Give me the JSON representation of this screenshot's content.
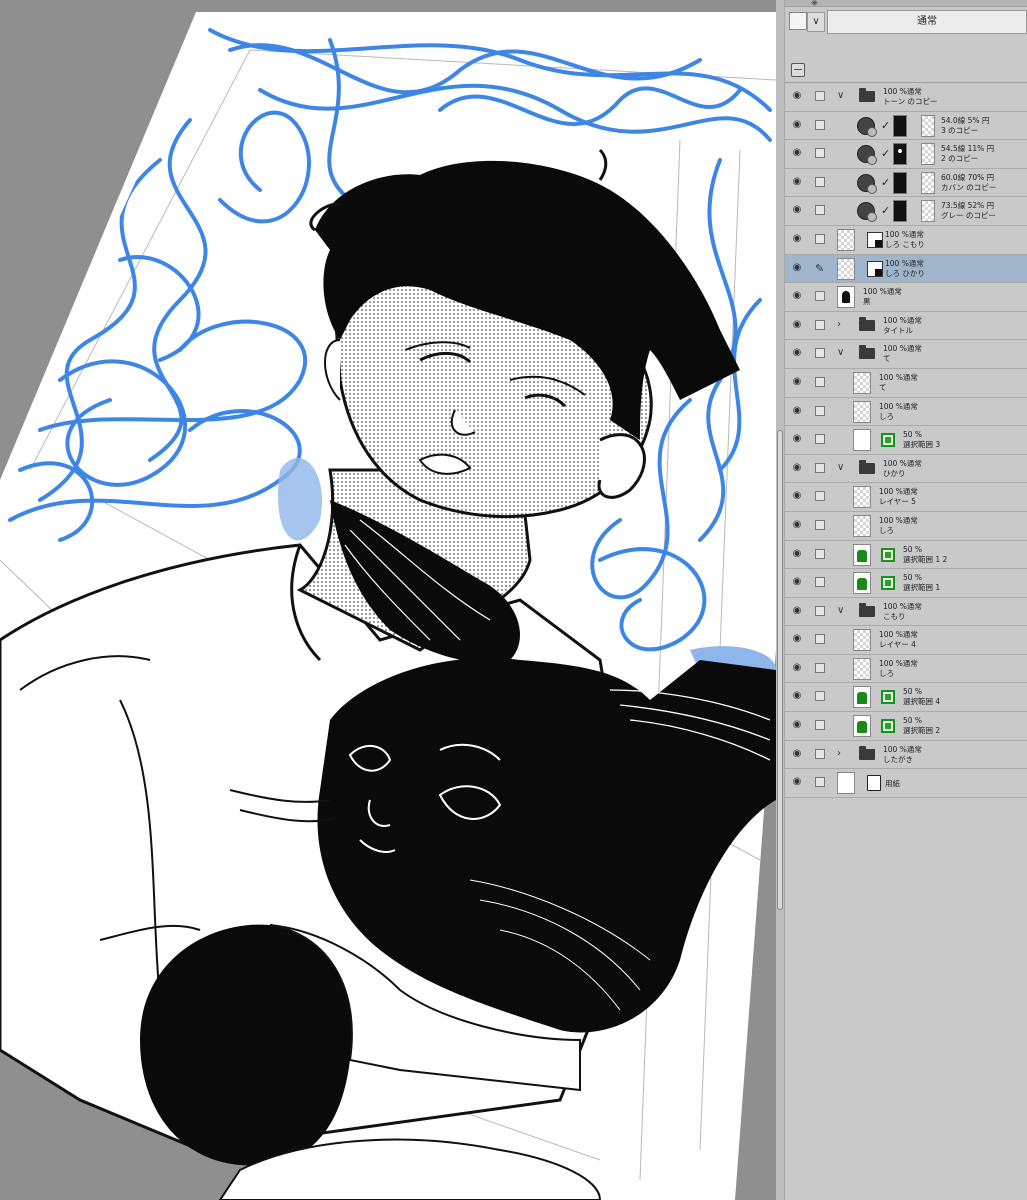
{
  "panel": {
    "blend_mode": "通常",
    "swatch_dropdown": "∨"
  },
  "layers": [
    {
      "kind": "folder",
      "expanded": true,
      "line1": "100 %通常",
      "line2": "トーン のコピー"
    },
    {
      "kind": "tone",
      "mask": "plain",
      "line1": "54.0線 5% 円",
      "line2": "3 のコピー"
    },
    {
      "kind": "tone",
      "mask": "spot",
      "line1": "54.5線 11% 円",
      "line2": "2 のコピー"
    },
    {
      "kind": "tone",
      "mask": "plain",
      "line1": "60.0線 70% 円",
      "line2": "カバン のコピー"
    },
    {
      "kind": "tone",
      "mask": "plain",
      "line1": "73.5線 52% 円",
      "line2": "グレー のコピー"
    },
    {
      "kind": "raster-mask",
      "line1": "100 %通常",
      "line2": "しろ こもり"
    },
    {
      "kind": "raster-mask",
      "selected": true,
      "line1": "100 %通常",
      "line2": "しろ ひかり"
    },
    {
      "kind": "figure",
      "line1": "100 %通常",
      "line2": "黒"
    },
    {
      "kind": "folder",
      "expanded": false,
      "line1": "100 %通常",
      "line2": "タイトル"
    },
    {
      "kind": "folder",
      "expanded": true,
      "line1": "100 %通常",
      "line2": "て"
    },
    {
      "kind": "raster",
      "line1": "100 %通常",
      "line2": "て"
    },
    {
      "kind": "raster",
      "line1": "100 %通常",
      "line2": "しろ"
    },
    {
      "kind": "selection",
      "thumb": "white",
      "line1": "50 %",
      "line2": "選択範囲 3"
    },
    {
      "kind": "folder",
      "expanded": true,
      "line1": "100 %通常",
      "line2": "ひかり"
    },
    {
      "kind": "raster",
      "line1": "100 %通常",
      "line2": "レイヤー 5"
    },
    {
      "kind": "raster",
      "line1": "100 %通常",
      "line2": "しろ"
    },
    {
      "kind": "selection",
      "thumb": "green",
      "line1": "50 %",
      "line2": "選択範囲 1 2"
    },
    {
      "kind": "selection",
      "thumb": "green",
      "line1": "50 %",
      "line2": "選択範囲 1"
    },
    {
      "kind": "folder",
      "expanded": true,
      "line1": "100 %通常",
      "line2": "こもり"
    },
    {
      "kind": "raster",
      "line1": "100 %通常",
      "line2": "レイヤー 4"
    },
    {
      "kind": "raster",
      "line1": "100 %通常",
      "line2": "しろ"
    },
    {
      "kind": "selection",
      "thumb": "green",
      "line1": "50 %",
      "line2": "選択範囲 4"
    },
    {
      "kind": "selection",
      "thumb": "green",
      "line1": "50 %",
      "line2": "選択範囲 2"
    },
    {
      "kind": "folder",
      "expanded": false,
      "line1": "100 %通常",
      "line2": "したがき"
    },
    {
      "kind": "paper",
      "line1": "",
      "line2": "用紙"
    }
  ],
  "colors": {
    "sketch_blue": "#3d86e6",
    "panel_bg": "#c9c9c9",
    "selected_row": "#9fb5cc"
  }
}
